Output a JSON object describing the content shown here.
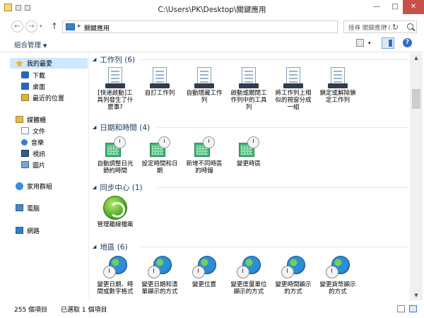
{
  "window": {
    "title": "C:\\Users\\PK\\Desktop\\關鍵應用",
    "min_label": "—",
    "max_label": "□",
    "close_label": "✕"
  },
  "address": {
    "back": "←",
    "forward": "→",
    "up": "↑",
    "path": "關鍵應用",
    "refresh": "↻",
    "search_placeholder": "搜尋 關鍵應用 (..."
  },
  "toolbar": {
    "organize_label": "組合管理",
    "help_label": "?"
  },
  "nav": {
    "favorites": "我的最愛",
    "downloads": "下載",
    "desktop": "桌面",
    "recent": "最近的位置",
    "libraries": "媒體櫃",
    "documents": "文件",
    "music": "音樂",
    "videos": "視訊",
    "pictures": "圖片",
    "homegroup": "家用群組",
    "computer": "電腦",
    "network": "網路"
  },
  "groups": {
    "taskbar": {
      "label": "工作列 (6)",
      "items": [
        "[快速啟動]工具列發生了什麼事?",
        "自訂工作列",
        "自動隱藏工作列",
        "啟動或關閉工作列中的工具列",
        "將工作列上相似的視窗分成一組",
        "鎖定或解除鎖定工作列"
      ]
    },
    "datetime": {
      "label": "日期和時間 (4)",
      "items": [
        "自動調整日光節約時間",
        "設定時間和日期",
        "新增不同時區的時鐘",
        "變更時區"
      ]
    },
    "sync": {
      "label": "同步中心 (1)",
      "items": [
        "管理離線檔案"
      ]
    },
    "region": {
      "label": "地區 (6)",
      "items": [
        "變更日期、時間或數字格式",
        "變更日期和清單顯示的方式",
        "變更位置",
        "變更度量單位顯示的方式",
        "變更時間顯示的方式",
        "變更貨幣顯示的方式"
      ]
    }
  },
  "status": {
    "count": "255 個項目",
    "selected": "已選取 1 個項目"
  }
}
